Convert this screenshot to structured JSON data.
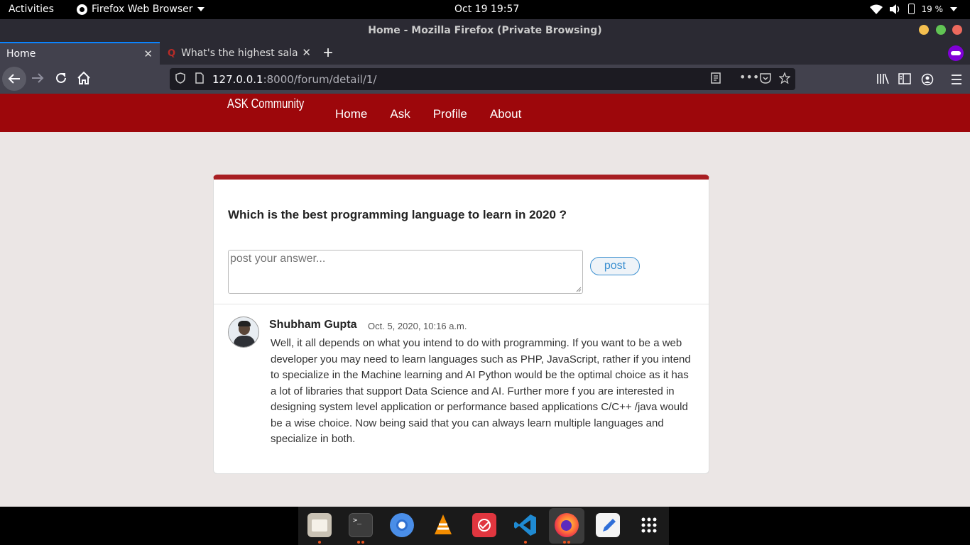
{
  "system_bar": {
    "activities": "Activities",
    "app_name": "Firefox Web Browser",
    "clock": "Oct 19  19:57",
    "battery": "19 %"
  },
  "window": {
    "title": "Home - Mozilla Firefox (Private Browsing)"
  },
  "tabs": [
    {
      "label": "Home",
      "active": true
    },
    {
      "label": "What's the highest salary",
      "active": false
    }
  ],
  "url": {
    "host": "127.0.0.1",
    "rest": ":8000/forum/detail/1/"
  },
  "site": {
    "brand": "ASK Community",
    "nav": [
      "Home",
      "Ask",
      "Profile",
      "About"
    ],
    "accent_color": "#9d070b"
  },
  "question": {
    "title": "Which is the best programming language to learn in 2020 ?",
    "answer_placeholder": "post your answer...",
    "post_label": "post"
  },
  "answers": [
    {
      "author": "Shubham Gupta",
      "date": "Oct. 5, 2020, 10:16 a.m.",
      "text": "Well, it all depends on what you intend to do with programming. If you want to be a web developer you may need to learn languages such as PHP, JavaScript, rather if you intend to specialize in the Machine learning and AI Python would be the optimal choice as it has a lot of libraries that support Data Science and AI. Further more f you are interested in designing system level application or performance based applications C/C++ /java would be a wise choice. Now being said that you can always learn multiple languages and specialize in both."
    }
  ],
  "dock": {
    "apps": [
      "files-icon",
      "terminal-icon",
      "chromium-icon",
      "vlc-icon",
      "todo-icon",
      "vscode-icon",
      "firefox-icon",
      "text-editor-icon",
      "app-grid-icon"
    ]
  }
}
